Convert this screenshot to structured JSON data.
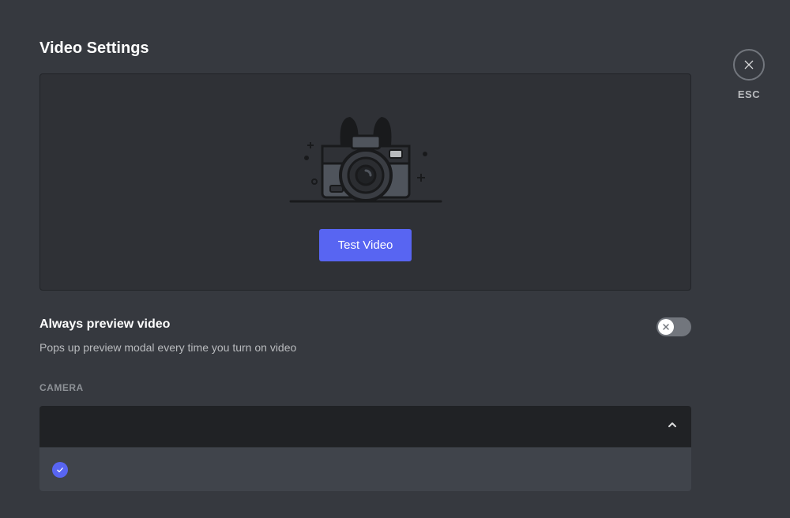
{
  "title": "Video Settings",
  "test_button_label": "Test Video",
  "always_preview": {
    "title": "Always preview video",
    "description": "Pops up preview modal every time you turn on video",
    "enabled": false
  },
  "camera_section_label": "CAMERA",
  "camera_selected": "",
  "close_label": "ESC"
}
